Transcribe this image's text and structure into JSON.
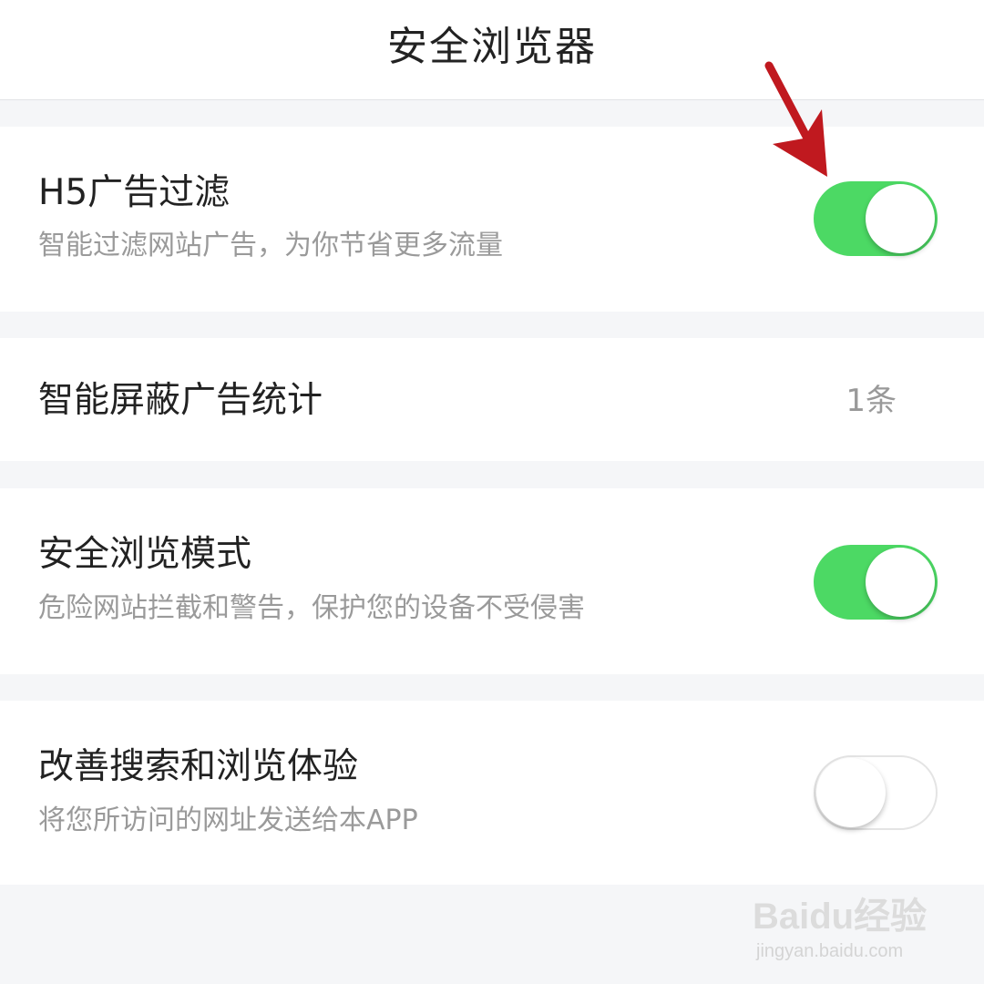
{
  "header": {
    "title": "安全浏览器"
  },
  "settings": [
    {
      "title": "H5广告过滤",
      "subtitle": "智能过滤网站广告，为你节省更多流量",
      "toggle_on": true
    },
    {
      "title": "智能屏蔽广告统计",
      "value": "1条"
    },
    {
      "title": "安全浏览模式",
      "subtitle": "危险网站拦截和警告，保护您的设备不受侵害",
      "toggle_on": true
    },
    {
      "title": "改善搜索和浏览体验",
      "subtitle": "将您所访问的网址发送给本APP",
      "toggle_on": false
    }
  ],
  "colors": {
    "toggle_on": "#4cd964",
    "annotation_arrow": "#c0191f"
  },
  "watermark": {
    "brand": "Baidu经验",
    "url": "jingyan.baidu.com"
  }
}
